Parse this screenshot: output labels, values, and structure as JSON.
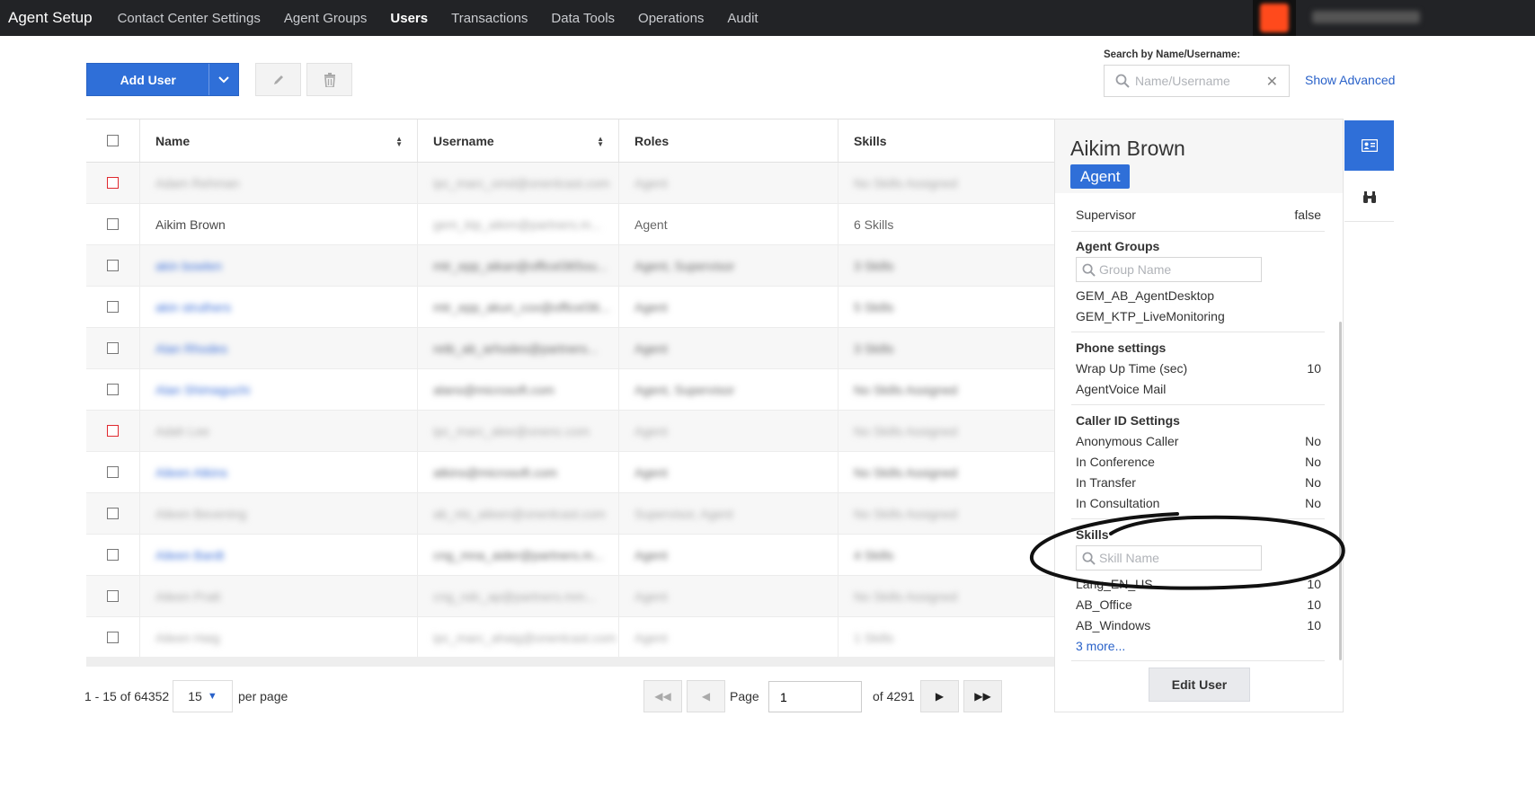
{
  "nav": {
    "brand": "Agent Setup",
    "items": [
      {
        "label": "Contact Center Settings",
        "active": false
      },
      {
        "label": "Agent Groups",
        "active": false
      },
      {
        "label": "Users",
        "active": true
      },
      {
        "label": "Transactions",
        "active": false
      },
      {
        "label": "Data Tools",
        "active": false
      },
      {
        "label": "Operations",
        "active": false
      },
      {
        "label": "Audit",
        "active": false
      }
    ]
  },
  "toolbar": {
    "add_user_label": "Add User",
    "edit_icon": "pencil-icon",
    "delete_icon": "trash-icon"
  },
  "search": {
    "label": "Search by Name/Username:",
    "placeholder": "Name/Username",
    "show_advanced": "Show Advanced"
  },
  "table": {
    "columns": [
      "Name",
      "Username",
      "Roles",
      "Skills"
    ],
    "rows": [
      {
        "name": "Adam Rehman",
        "username": "ipc_marc_omd@onenlcast.com",
        "roles": "Agent",
        "skills": "No Skills Assigned",
        "style": "light",
        "checkbox": "red"
      },
      {
        "name": "Aikim Brown",
        "username": "gem_ktp_aikim@partners.m...",
        "roles": "Agent",
        "skills": "6 Skills",
        "style": "focus",
        "checkbox": "normal"
      },
      {
        "name": "akin bowlen",
        "username": "mtr_epp_aikan@officel365ou...",
        "roles": "Agent, Supervisor",
        "skills": "3 Skills",
        "style": "link",
        "checkbox": "normal"
      },
      {
        "name": "akin struthers",
        "username": "mtr_epp_akun_cox@officel36...",
        "roles": "Agent",
        "skills": "5 Skills",
        "style": "link",
        "checkbox": "normal"
      },
      {
        "name": "Alan Rhodes",
        "username": "retb_ab_arhodes@partners...",
        "roles": "Agent",
        "skills": "3 Skills",
        "style": "link",
        "checkbox": "normal"
      },
      {
        "name": "Alan Shimaguchi",
        "username": "alans@microsoft.com",
        "roles": "Agent, Supervisor",
        "skills": "No Skills Assigned",
        "style": "link",
        "checkbox": "normal"
      },
      {
        "name": "Adah Lee",
        "username": "ipc_marc_alee@onenc.com",
        "roles": "Agent",
        "skills": "No Skills Assigned",
        "style": "light",
        "checkbox": "red"
      },
      {
        "name": "Aileen Atkins",
        "username": "atkins@microsoft.com",
        "roles": "Agent",
        "skills": "No Skills Assigned",
        "style": "link",
        "checkbox": "normal"
      },
      {
        "name": "Aileen Bevening",
        "username": "ab_nts_aileen@onenlcast.com",
        "roles": "Supervisor, Agent",
        "skills": "No Skills Assigned",
        "style": "light",
        "checkbox": "normal"
      },
      {
        "name": "Aileen Bardt",
        "username": "cng_mna_aider@partners.m...",
        "roles": "Agent",
        "skills": "4 Skills",
        "style": "link",
        "checkbox": "normal"
      },
      {
        "name": "Aileen Pratt",
        "username": "cng_ndc_ap@partners.mm...",
        "roles": "Agent",
        "skills": "No Skills Assigned",
        "style": "light",
        "checkbox": "normal"
      },
      {
        "name": "Aileen Haig",
        "username": "ipc_marc_ahaig@onenlcast.com",
        "roles": "Agent",
        "skills": "1 Skills",
        "style": "light",
        "checkbox": "normal"
      }
    ]
  },
  "pagination": {
    "range": "1 - 15 of 64352",
    "page_size": "15",
    "per_page": "per page",
    "page_label": "Page",
    "current_page": "1",
    "of_pages": "of 4291"
  },
  "panel": {
    "name": "Aikim Brown",
    "role_badge": "Agent",
    "supervisor_label": "Supervisor",
    "supervisor_value": "false",
    "agent_groups_title": "Agent Groups",
    "group_placeholder": "Group Name",
    "groups": [
      "GEM_AB_AgentDesktop",
      "GEM_KTP_LiveMonitoring"
    ],
    "phone_title": "Phone settings",
    "phone": [
      {
        "label": "Wrap Up Time (sec)",
        "value": "10"
      },
      {
        "label": "AgentVoice Mail",
        "value": ""
      }
    ],
    "caller_id_title": "Caller ID Settings",
    "caller_id": [
      {
        "label": "Anonymous Caller",
        "value": "No"
      },
      {
        "label": "In Conference",
        "value": "No"
      },
      {
        "label": "In Transfer",
        "value": "No"
      },
      {
        "label": "In Consultation",
        "value": "No"
      }
    ],
    "skills_title": "Skills",
    "skill_placeholder": "Skill Name",
    "skills": [
      {
        "label": "Lang_EN_US",
        "value": "10"
      },
      {
        "label": "AB_Office",
        "value": "10"
      },
      {
        "label": "AB_Windows",
        "value": "10"
      }
    ],
    "more_link": "3 more...",
    "edit_button": "Edit User"
  },
  "rail": {
    "items": [
      "contact-card-icon",
      "binoculars-icon"
    ]
  },
  "colors": {
    "accent": "#2f6fd8",
    "nav_bg": "#222326",
    "link": "#2a62c9",
    "annotation": "#111111"
  }
}
